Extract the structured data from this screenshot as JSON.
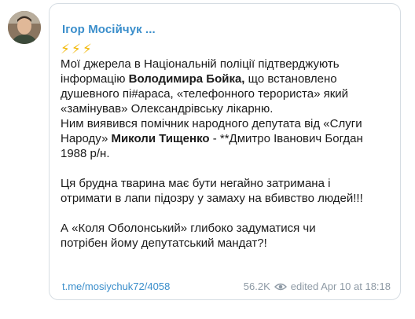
{
  "post": {
    "author": "Ігор Мосійчук ...",
    "emoji": "⚡⚡⚡",
    "lines": {
      "l1": "Мої джерела в Національній поліції підтверджують",
      "l2_pre": "інформацію ",
      "l2_bold": "Володимира Бойка,",
      "l2_post": " що встановлено",
      "l3": "душевного пі#араса, «телефонного терориста» який",
      "l4": "«замінував» Олександрівську лікарню.",
      "l5": "Ним виявився помічник народного депутата від «Слуги",
      "l6_pre": "Народу» ",
      "l6_bold": "Миколи Тищенко",
      "l6_post": " - **Дмитро Іванович Богдан",
      "l7": "1988 р/н.",
      "l8": "Ця брудна тварина має бути негайно затримана і",
      "l9": "отримати в лапи підозру у замаху на вбивство людей!!!",
      "l10": "А «Коля Оболонський» глибоко задуматися чи",
      "l11": "потрібен йому депутатський мандат?!"
    }
  },
  "footer": {
    "link": "t.me/mosiychuk72/4058",
    "views": "56.2K",
    "edited": "edited  Apr 10 at 18:18"
  },
  "colors": {
    "accent": "#3a8ecb",
    "meta": "#8e9aa5",
    "border": "#d6dde3"
  }
}
